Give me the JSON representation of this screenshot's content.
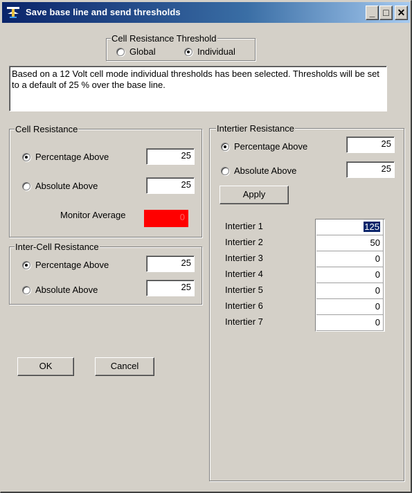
{
  "window": {
    "title": "Save base line and send thresholds",
    "minimize": "_",
    "maximize": "□",
    "close": "✕",
    "icon": "app-icon"
  },
  "threshold_mode": {
    "legend": "Cell Resistance Threshold",
    "options": [
      "Global",
      "Individual"
    ],
    "selected": "Individual"
  },
  "info_text": "Based on a 12 Volt cell mode individual thresholds has been selected. Thresholds will be set to a default of 25 % over the base line.",
  "cell_resistance": {
    "legend": "Cell Resistance",
    "percentage_label": "Percentage Above",
    "percentage_value": "25",
    "absolute_label": "Absolute Above",
    "absolute_value": "25",
    "selected": "Percentage Above",
    "monitor_label": "Monitor Average",
    "monitor_value": "0",
    "monitor_color": "#ff0000"
  },
  "inter_cell_resistance": {
    "legend": "Inter-Cell Resistance",
    "percentage_label": "Percentage Above",
    "percentage_value": "25",
    "absolute_label": "Absolute Above",
    "absolute_value": "25",
    "selected": "Percentage Above"
  },
  "intertier_resistance": {
    "legend": "Intertier Resistance",
    "percentage_label": "Percentage Above",
    "percentage_value": "25",
    "absolute_label": "Absolute Above",
    "absolute_value": "25",
    "selected": "Percentage Above",
    "apply_label": "Apply",
    "rows": [
      {
        "label": "Intertier 1",
        "value": "125",
        "selected": true
      },
      {
        "label": "Intertier 2",
        "value": "50"
      },
      {
        "label": "Intertier 3",
        "value": "0"
      },
      {
        "label": "Intertier 4",
        "value": "0"
      },
      {
        "label": "Intertier 5",
        "value": "0"
      },
      {
        "label": "Intertier 6",
        "value": "0"
      },
      {
        "label": "Intertier 7",
        "value": "0"
      }
    ]
  },
  "buttons": {
    "ok": "OK",
    "cancel": "Cancel"
  },
  "colors": {
    "titlebar_start": "#0a246a",
    "titlebar_end": "#a6caf0",
    "face": "#d4d0c8",
    "monitor_alarm": "#ff0000",
    "selection": "#0a246a"
  }
}
